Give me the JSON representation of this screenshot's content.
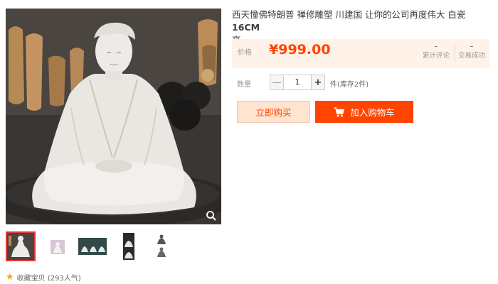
{
  "product": {
    "title": "西天憧佛特朗普 禅修雕塑 川建国 让你的公司再度伟大 白瓷",
    "title_bold": "16CM",
    "title_tail": "高"
  },
  "price": {
    "label": "价格",
    "value": "¥999.00",
    "stats": [
      {
        "num": "-",
        "label": "累计评论"
      },
      {
        "num": "-",
        "label": "交易成功"
      }
    ]
  },
  "quantity": {
    "label": "数量",
    "value": "1",
    "minus": "—",
    "plus": "+",
    "stock": "件(库存2件)"
  },
  "actions": {
    "buy_now": "立即购买",
    "add_to_cart": "加入购物车"
  },
  "favorite": {
    "label": "收藏宝贝 (293人气)"
  },
  "icons": {
    "zoom": "search-icon",
    "cart": "cart-icon",
    "star": "star-icon"
  },
  "colors": {
    "accent": "#ff4400",
    "price_bg": "#fff2e8",
    "buy_bg": "#ffe4d0",
    "thumb_active": "#e4393c",
    "star": "#f3a41e"
  }
}
